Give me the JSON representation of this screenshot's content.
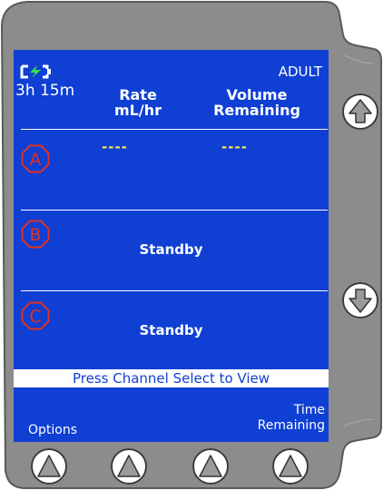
{
  "status_bar": {
    "battery_icon": "battery-charging-icon",
    "battery_time": "3h 15m",
    "mode": "ADULT"
  },
  "columns": {
    "rate_line1": "Rate",
    "rate_line2": "mL/hr",
    "volume_line1": "Volume",
    "volume_line2": "Remaining"
  },
  "channels": [
    {
      "label": "A",
      "rate": "----",
      "volume": "----"
    },
    {
      "label": "B",
      "status": "Standby"
    },
    {
      "label": "C",
      "status": "Standby"
    }
  ],
  "prompt": "Press Channel Select to View",
  "softkeys": {
    "options": "Options",
    "time_line1": "Time",
    "time_line2": "Remaining"
  },
  "colors": {
    "screen": "#0f3fd3",
    "channel_badge": "#e0311f",
    "dashes": "#ffe54d",
    "battery_bolt": "#39e04a",
    "bezel": "#8c8c8c"
  }
}
